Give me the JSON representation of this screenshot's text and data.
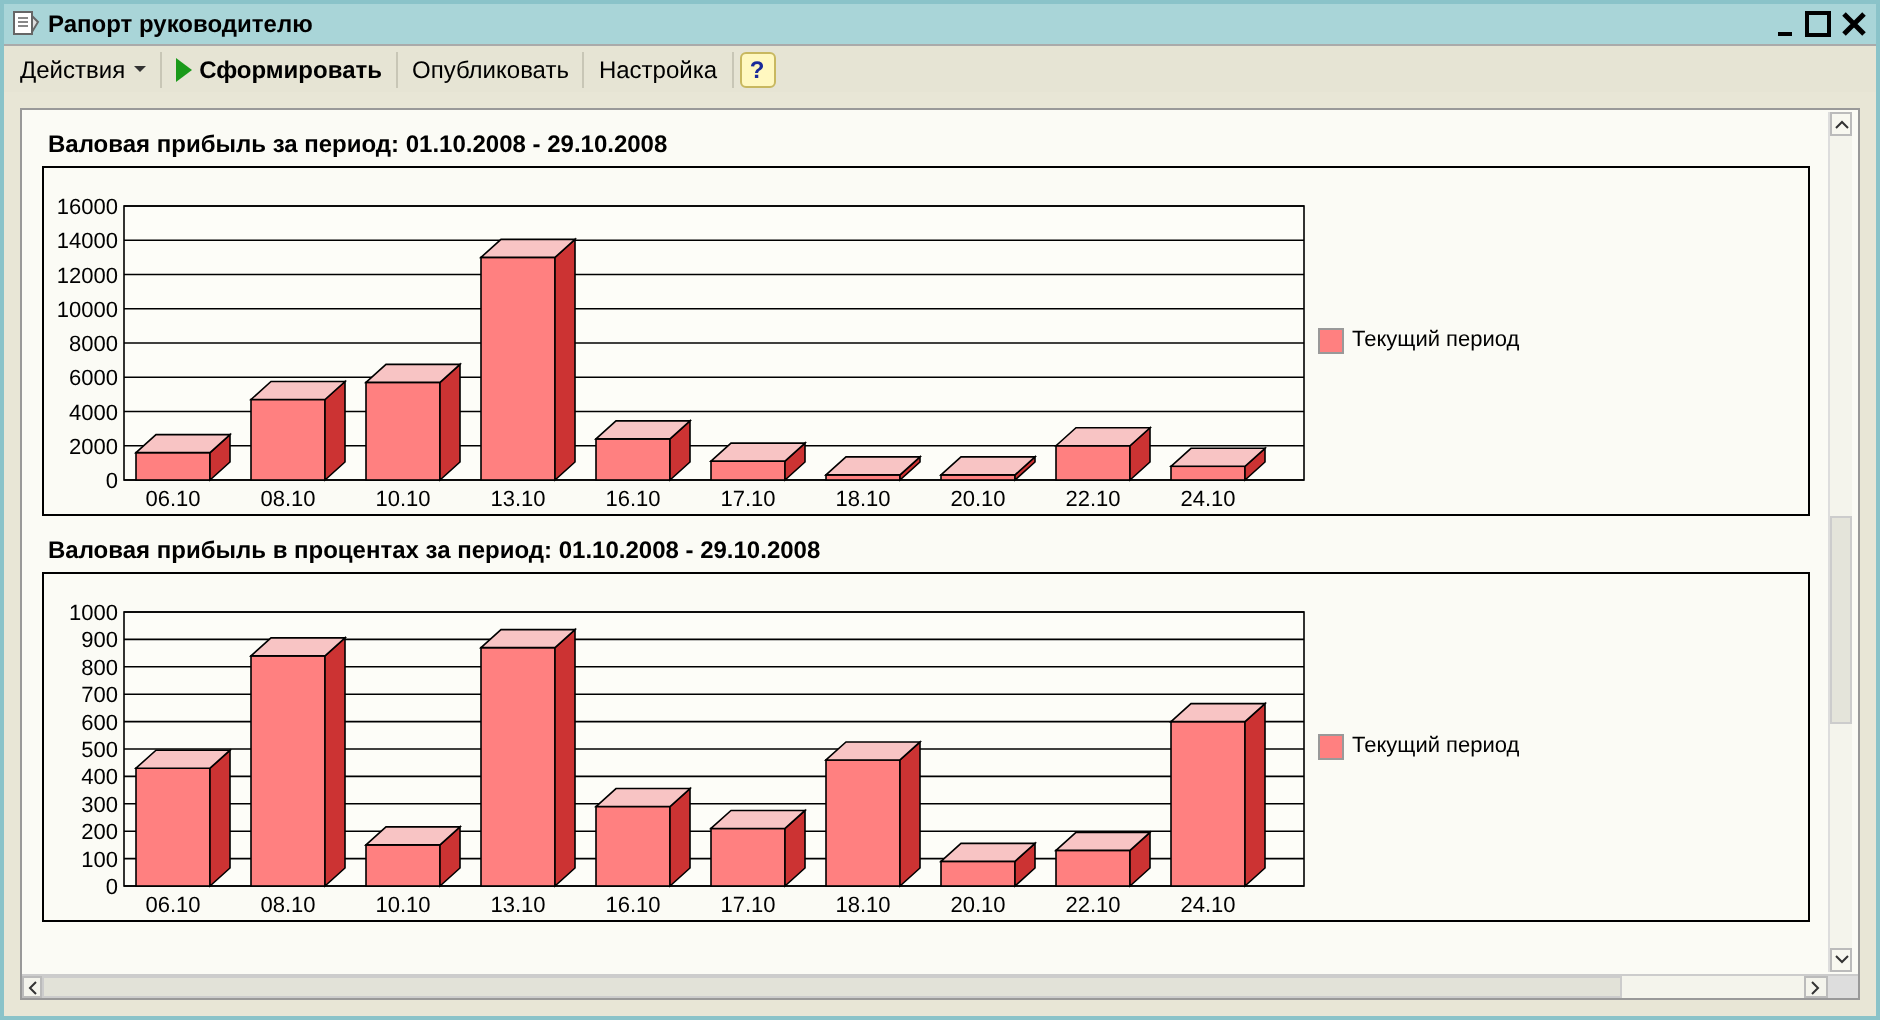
{
  "window": {
    "title": "Рапорт руководителю"
  },
  "toolbar": [
    {
      "kind": "menu",
      "label": "Действия"
    },
    {
      "kind": "run",
      "label": "Сформировать"
    },
    {
      "kind": "plain",
      "label": "Опубликовать"
    },
    {
      "kind": "plain",
      "label": "Настройка"
    },
    {
      "kind": "help",
      "label": "?"
    }
  ],
  "sections": [
    {
      "title": "Валовая прибыль за период: 01.10.2008 - 29.10.2008",
      "chart_data": {
        "type": "bar",
        "categories": [
          "06.10",
          "08.10",
          "10.10",
          "13.10",
          "16.10",
          "17.10",
          "18.10",
          "20.10",
          "22.10",
          "24.10"
        ],
        "series": [
          {
            "name": "Текущий период",
            "color": "#ff8080",
            "values": [
              1600,
              4700,
              5700,
              13000,
              2400,
              1100,
              300,
              300,
              2000,
              800
            ]
          }
        ],
        "ylim": [
          0,
          16000
        ],
        "yticks": [
          0,
          2000,
          4000,
          6000,
          8000,
          10000,
          12000,
          14000,
          16000
        ],
        "grid": true
      }
    },
    {
      "title": "Валовая прибыль в процентах за период: 01.10.2008 - 29.10.2008",
      "chart_data": {
        "type": "bar",
        "categories": [
          "06.10",
          "08.10",
          "10.10",
          "13.10",
          "16.10",
          "17.10",
          "18.10",
          "20.10",
          "22.10",
          "24.10"
        ],
        "series": [
          {
            "name": "Текущий период",
            "color": "#ff8080",
            "values": [
              430,
              840,
              150,
              870,
              290,
              210,
              460,
              90,
              130,
              600
            ]
          }
        ],
        "ylim": [
          0,
          1000
        ],
        "yticks": [
          0,
          100,
          200,
          300,
          400,
          500,
          600,
          700,
          800,
          900,
          1000
        ],
        "grid": true
      }
    }
  ]
}
